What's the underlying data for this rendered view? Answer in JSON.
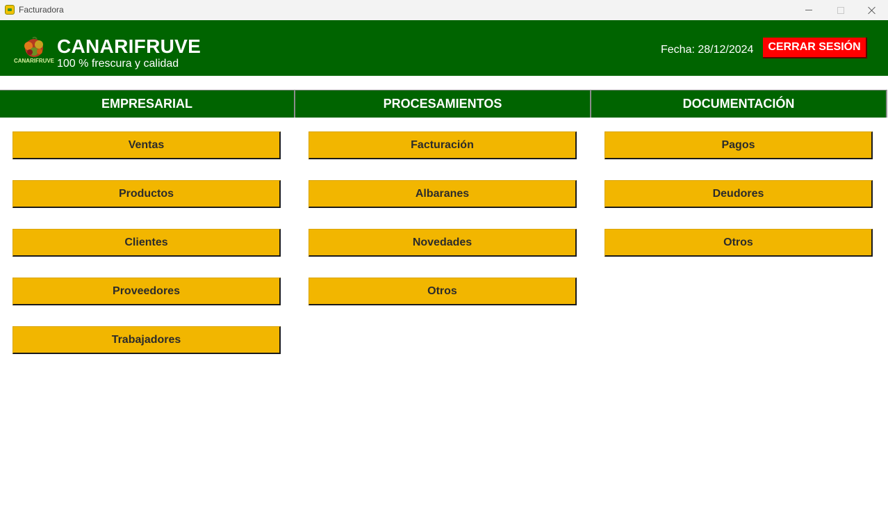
{
  "window": {
    "title": "Facturadora"
  },
  "header": {
    "brand_name": "CANARIFRUVE",
    "slogan": "100 % frescura y calidad",
    "logo_text": "CANARIFRUVE",
    "date_label": "Fecha:",
    "date_value": "28/12/2024",
    "logout_label": "CERRAR SESIÓN"
  },
  "sections": [
    {
      "title": "EMPRESARIAL",
      "buttons": [
        "Ventas",
        "Productos",
        "Clientes",
        "Proveedores",
        "Trabajadores"
      ]
    },
    {
      "title": "PROCESAMIENTOS",
      "buttons": [
        "Facturación",
        "Albaranes",
        "Novedades",
        "Otros"
      ]
    },
    {
      "title": "DOCUMENTACIÓN",
      "buttons": [
        "Pagos",
        "Deudores",
        "Otros"
      ]
    }
  ],
  "colors": {
    "header_green": "#006400",
    "button_yellow": "#f2b600",
    "logout_red": "#ff0000"
  },
  "icons": {
    "app": "app-icon",
    "logo": "fruit-basket-logo",
    "minimize": "minimize-icon",
    "maximize": "maximize-icon",
    "close": "close-icon"
  }
}
